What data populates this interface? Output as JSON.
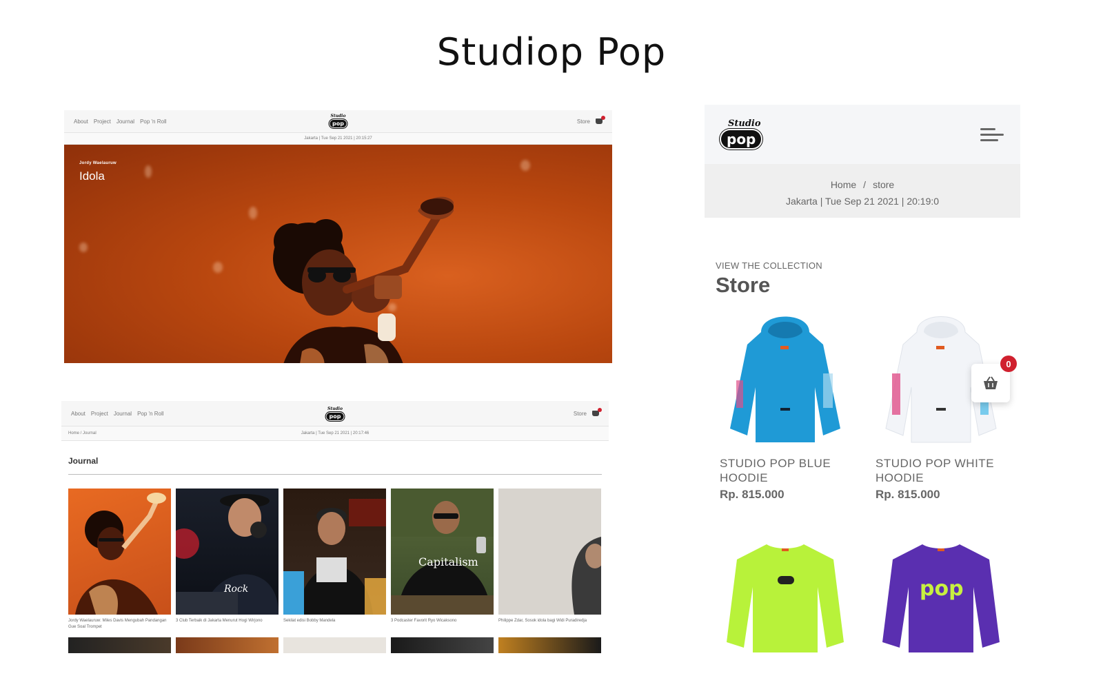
{
  "page": {
    "title": "Studiop Pop"
  },
  "site": {
    "logo_script": "Studio",
    "logo_pill": "pop",
    "nav": [
      "About",
      "Project",
      "Journal",
      "Pop 'n Roll"
    ],
    "store_link": "Store"
  },
  "hero_screen": {
    "datetime": "Jakarta | Tue Sep 21 2021 | 20:15:27",
    "hero": {
      "author": "Jordy Waelauruw",
      "title": "Idola"
    },
    "colors": {
      "hero": "#c4521a",
      "accent": "#d0202e"
    }
  },
  "journal_screen": {
    "breadcrumb": "Home  /  Journal",
    "datetime": "Jakarta | Tue Sep 21 2021 | 20:17:46",
    "section_title": "Journal",
    "articles": [
      {
        "caption": "Jordy Waelauruw: Miles Davis Mengubah Pandangan Gue Soal Trompet",
        "image": "trumpet-player-orange"
      },
      {
        "caption": "3 Club Terbaik di Jakarta Menurut Hogi Wirjono",
        "image": "dj-at-decks"
      },
      {
        "caption": "Sekilat edisi Bobby Mandela",
        "image": "man-in-crowd"
      },
      {
        "caption": "3 Podcaster Favorit Ryo Wicaksono",
        "image": "man-capitalism-shirt"
      },
      {
        "caption": "Philippe Zdar, Sosok idola bagi Widi Puradiredja",
        "image": "man-grey-background"
      }
    ]
  },
  "store_screen": {
    "breadcrumb": {
      "home": "Home",
      "sep": "/",
      "current": "store"
    },
    "datetime": "Jakarta | Tue Sep 21 2021 | 20:19:0",
    "eyebrow": "VIEW THE COLLECTION",
    "title": "Store",
    "cart_count": "0",
    "products": [
      {
        "name": "STUDIO POP BLUE HOODIE",
        "price": "Rp. 815.000",
        "image": "blue-hoodie",
        "color": "#1f9ad6"
      },
      {
        "name": "STUDIO POP WHITE HOODIE",
        "price": "Rp. 815.000",
        "image": "white-hoodie",
        "color": "#f2f4f8"
      },
      {
        "name": "",
        "price": "",
        "image": "lime-sweatshirt",
        "color": "#b8f23a"
      },
      {
        "name": "",
        "price": "",
        "image": "purple-sweatshirt",
        "color": "#5a2fb0"
      }
    ]
  }
}
